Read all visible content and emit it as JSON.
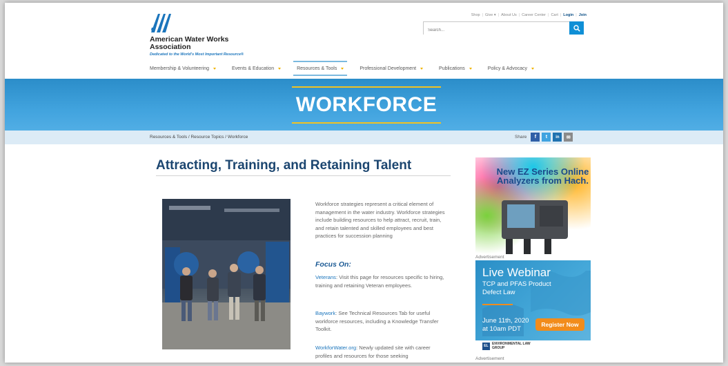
{
  "logo": {
    "name": "American Water Works Association",
    "tagline": "Dedicated to the World's Most Important Resource®"
  },
  "utility_links": [
    "Shop",
    "Give ▾",
    "About Us",
    "Career Center",
    "Cart",
    "Login",
    "Join"
  ],
  "search": {
    "placeholder": "Search..."
  },
  "nav": [
    {
      "label": "Membership & Volunteering"
    },
    {
      "label": "Events & Education"
    },
    {
      "label": "Resources & Tools"
    },
    {
      "label": "Professional Development"
    },
    {
      "label": "Publications"
    },
    {
      "label": "Policy & Advocacy"
    }
  ],
  "banner": {
    "title": "WORKFORCE"
  },
  "breadcrumb": "Resources & Tools / Resource Topics / Workforce",
  "share": {
    "label": "Share",
    "buttons": [
      "f",
      "t",
      "in",
      "✉"
    ]
  },
  "main": {
    "title": "Attracting, Training, and Retaining Talent",
    "intro": "Workforce strategies represent a critical element of management in the water industry. Workforce strategies include building resources to help attract, recruit, train, and retain talented and skilled employees and best practices for succession planning",
    "focus_heading": "Focus On:",
    "items": [
      {
        "link": "Veterans",
        "text": ": Visit this page for resources specific to hiring, training and retaining Veteran employees."
      },
      {
        "link": "Baywork",
        "text": ": See Technical Resources Tab for useful workforce resources, including a Knowledge Transfer Toolkit."
      },
      {
        "link": "WorkforWater.org",
        "text": ": Newly updated site with career profiles and resources for those seeking"
      }
    ]
  },
  "ads": {
    "ad1": {
      "headline": "New EZ Series Online Analyzers from Hach.",
      "caption": "Advertisement"
    },
    "ad2": {
      "title": "Live Webinar",
      "subtitle": "TCP and PFAS Product Defect Law",
      "date": "June 11th, 2020 at 10am PDT",
      "cta": "Register Now",
      "sponsor": "ENVIRONMENTAL LAW GROUP",
      "caption": "Advertisement"
    }
  },
  "colors": {
    "brand_blue": "#1b75bc",
    "banner_blue": "#41a3de",
    "accent_yellow": "#f3c221",
    "search_button": "#0f8fd6",
    "cta_orange": "#f28c1b"
  }
}
